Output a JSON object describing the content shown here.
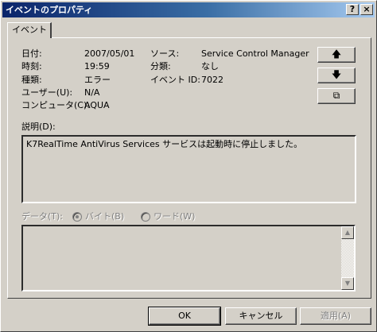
{
  "window": {
    "title": "イベントのプロパティ",
    "help_label": "?",
    "close_label": "×"
  },
  "tabs": [
    {
      "label": "イベント"
    }
  ],
  "fields": {
    "date": {
      "label": "日付:",
      "value": "2007/05/01"
    },
    "time": {
      "label": "時刻:",
      "value": "19:59"
    },
    "type": {
      "label": "種類:",
      "value": "エラー"
    },
    "user": {
      "label": "ユーザー(U):",
      "value": "N/A"
    },
    "computer": {
      "label": "コンピュータ(C):",
      "value": "AQUA"
    },
    "source": {
      "label": "ソース:",
      "value": "Service Control Manager"
    },
    "category": {
      "label": "分類:",
      "value": "なし"
    },
    "event_id": {
      "label": "イベント ID:",
      "value": "7022"
    }
  },
  "nav_buttons": {
    "up": "🡅",
    "down": "🡇",
    "copy": "⧉"
  },
  "description": {
    "label": "説明(D):",
    "text": "K7RealTime AntiVirus Services サービスは起動時に停止しました。"
  },
  "data_section": {
    "label": "データ(T):",
    "bytes_label": "バイト(B)",
    "words_label": "ワード(W)",
    "selected": "bytes"
  },
  "buttons": {
    "ok": "OK",
    "cancel": "キャンセル",
    "apply": "適用(A)"
  }
}
